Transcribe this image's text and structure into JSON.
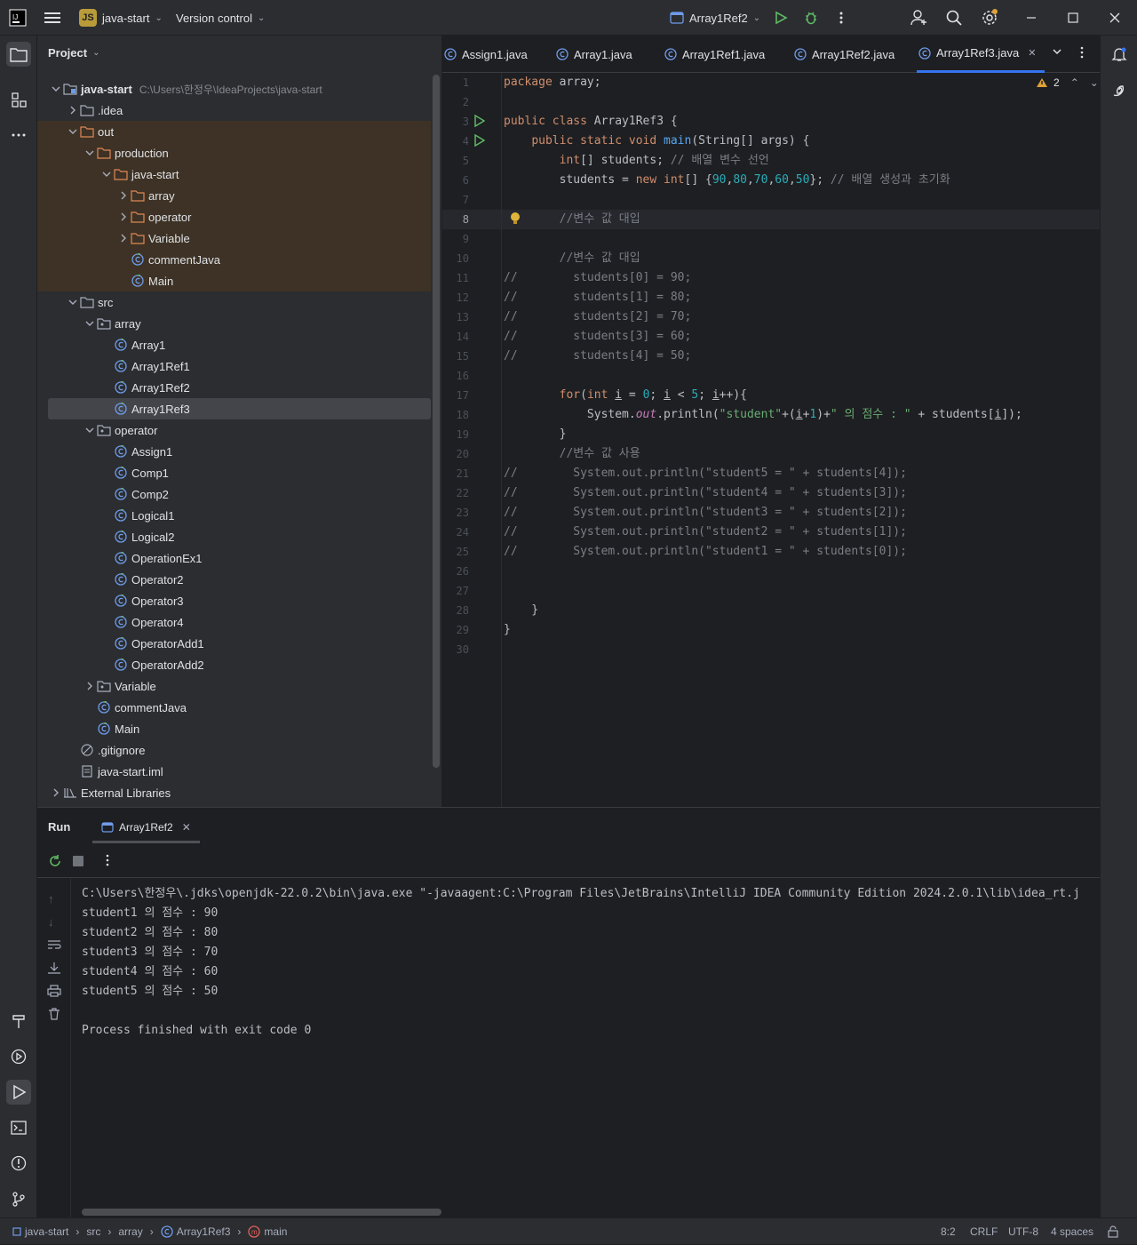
{
  "titlebar": {
    "project_badge": "JS",
    "project_name": "java-start",
    "vcs": "Version control",
    "run_config": "Array1Ref2"
  },
  "project_panel": {
    "title": "Project",
    "tree": [
      {
        "label": "java-start",
        "hint": "C:\\Users\\한정우\\IdeaProjects\\java-start",
        "type": "module",
        "chev": "down"
      },
      {
        "label": ".idea",
        "type": "folder",
        "chev": "right"
      },
      {
        "label": "out",
        "type": "folder-out",
        "chev": "down"
      },
      {
        "label": "production",
        "type": "folder-out",
        "chev": "down"
      },
      {
        "label": "java-start",
        "type": "folder-out",
        "chev": "down"
      },
      {
        "label": "array",
        "type": "folder-out",
        "chev": "right"
      },
      {
        "label": "operator",
        "type": "folder-out",
        "chev": "right"
      },
      {
        "label": "Variable",
        "type": "folder-out",
        "chev": "right"
      },
      {
        "label": "commentJava",
        "type": "class",
        "chev": ""
      },
      {
        "label": "Main",
        "type": "class",
        "chev": ""
      },
      {
        "label": "src",
        "type": "folder",
        "chev": "down"
      },
      {
        "label": "array",
        "type": "package",
        "chev": "down"
      },
      {
        "label": "Array1",
        "type": "class",
        "chev": ""
      },
      {
        "label": "Array1Ref1",
        "type": "class",
        "chev": ""
      },
      {
        "label": "Array1Ref2",
        "type": "class",
        "chev": ""
      },
      {
        "label": "Array1Ref3",
        "type": "class",
        "chev": ""
      },
      {
        "label": "operator",
        "type": "package",
        "chev": "down"
      },
      {
        "label": "Assign1",
        "type": "class",
        "chev": ""
      },
      {
        "label": "Comp1",
        "type": "class",
        "chev": ""
      },
      {
        "label": "Comp2",
        "type": "class",
        "chev": ""
      },
      {
        "label": "Logical1",
        "type": "class",
        "chev": ""
      },
      {
        "label": "Logical2",
        "type": "class",
        "chev": ""
      },
      {
        "label": "OperationEx1",
        "type": "class",
        "chev": ""
      },
      {
        "label": "Operator2",
        "type": "class",
        "chev": ""
      },
      {
        "label": "Operator3",
        "type": "class",
        "chev": ""
      },
      {
        "label": "Operator4",
        "type": "class",
        "chev": ""
      },
      {
        "label": "OperatorAdd1",
        "type": "class",
        "chev": ""
      },
      {
        "label": "OperatorAdd2",
        "type": "class",
        "chev": ""
      },
      {
        "label": "Variable",
        "type": "package",
        "chev": "right"
      },
      {
        "label": "commentJava",
        "type": "class",
        "chev": ""
      },
      {
        "label": "Main",
        "type": "class",
        "chev": ""
      },
      {
        "label": ".gitignore",
        "type": "ignore",
        "chev": ""
      },
      {
        "label": "java-start.iml",
        "type": "file",
        "chev": ""
      },
      {
        "label": "External Libraries",
        "type": "library",
        "chev": "right"
      }
    ]
  },
  "editor": {
    "tabs": [
      "Assign1.java",
      "Array1.java",
      "Array1Ref1.java",
      "Array1Ref2.java",
      "Array1Ref3.java"
    ],
    "active_tab": "Array1Ref3.java",
    "warnings": "2",
    "line_numbers": [
      "1",
      "2",
      "3",
      "4",
      "5",
      "6",
      "7",
      "8",
      "9",
      "10",
      "11",
      "12",
      "13",
      "14",
      "15",
      "16",
      "17",
      "18",
      "19",
      "20",
      "21",
      "22",
      "23",
      "24",
      "25",
      "26",
      "27",
      "28",
      "29",
      "30"
    ],
    "current_line": "8"
  },
  "run_panel": {
    "title": "Run",
    "tab": "Array1Ref2",
    "output": [
      "C:\\Users\\한정우\\.jdks\\openjdk-22.0.2\\bin\\java.exe \"-javaagent:C:\\Program Files\\JetBrains\\IntelliJ IDEA Community Edition 2024.2.0.1\\lib\\idea_rt.j",
      "student1 의 점수 : 90",
      "student2 의 점수 : 80",
      "student3 의 점수 : 70",
      "student4 의 점수 : 60",
      "student5 의 점수 : 50",
      "",
      "Process finished with exit code 0"
    ]
  },
  "statusbar": {
    "breadcrumb": [
      "java-start",
      "src",
      "array",
      "Array1Ref3",
      "main"
    ],
    "position": "8:2",
    "line_sep": "CRLF",
    "encoding": "UTF-8",
    "indent": "4 spaces"
  }
}
